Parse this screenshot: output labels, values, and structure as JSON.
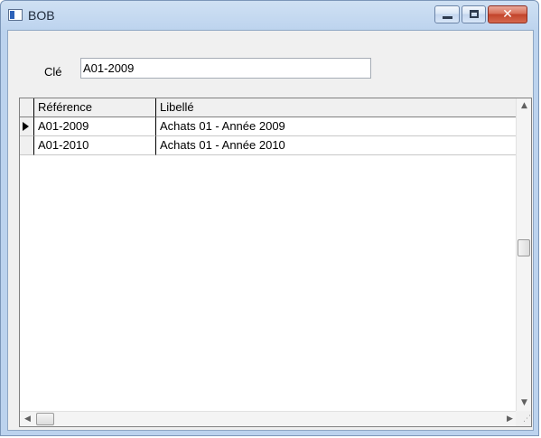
{
  "window": {
    "title": "BOB",
    "minimize_icon": "minimize-icon",
    "maximize_icon": "maximize-icon",
    "close_icon": "close-icon",
    "close_glyph": "✕"
  },
  "form": {
    "key_label": "Clé",
    "key_value": "A01-2009"
  },
  "grid": {
    "columns": [
      "Référence",
      "Libellé"
    ],
    "rows": [
      {
        "reference": "A01-2009",
        "libelle": "Achats 01 - Année 2009",
        "current": true
      },
      {
        "reference": "A01-2010",
        "libelle": "Achats 01 - Année 2010",
        "current": false
      }
    ]
  },
  "scrollbars": {
    "up_glyph": "▲",
    "down_glyph": "▼",
    "left_glyph": "◀",
    "right_glyph": "▶",
    "grip_glyph": "⋰"
  },
  "colors": {
    "title_bar": "#cfe0f3",
    "close_button": "#c2432a"
  }
}
